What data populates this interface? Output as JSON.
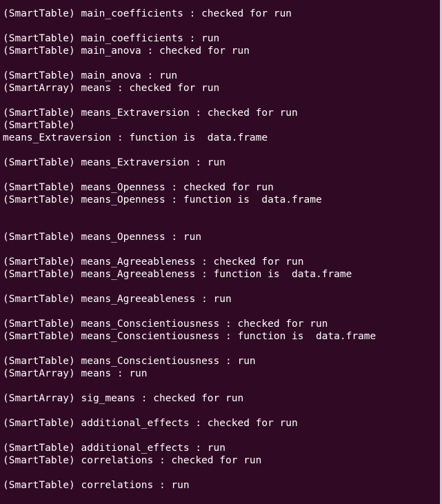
{
  "terminal": {
    "background": "#300a24",
    "foreground": "#ffffff",
    "lines": [
      "(SmartTable) main_coefficients : checked for run",
      "",
      "(SmartTable) main_coefficients : run",
      "(SmartTable) main_anova : checked for run",
      "",
      "(SmartTable) main_anova : run",
      "(SmartArray) means : checked for run",
      "",
      "(SmartTable) means_Extraversion : checked for run",
      "(SmartTable)",
      "means_Extraversion : function is  data.frame",
      "",
      "(SmartTable) means_Extraversion : run",
      "",
      "(SmartTable) means_Openness : checked for run",
      "(SmartTable) means_Openness : function is  data.frame",
      "",
      "",
      "(SmartTable) means_Openness : run",
      "",
      "(SmartTable) means_Agreeableness : checked for run",
      "(SmartTable) means_Agreeableness : function is  data.frame",
      "",
      "(SmartTable) means_Agreeableness : run",
      "",
      "(SmartTable) means_Conscientiousness : checked for run",
      "(SmartTable) means_Conscientiousness : function is  data.frame",
      "",
      "(SmartTable) means_Conscientiousness : run",
      "(SmartArray) means : run",
      "",
      "(SmartArray) sig_means : checked for run",
      "",
      "(SmartTable) additional_effects : checked for run",
      "",
      "(SmartTable) additional_effects : run",
      "(SmartTable) correlations : checked for run",
      "",
      "(SmartTable) correlations : run"
    ]
  }
}
